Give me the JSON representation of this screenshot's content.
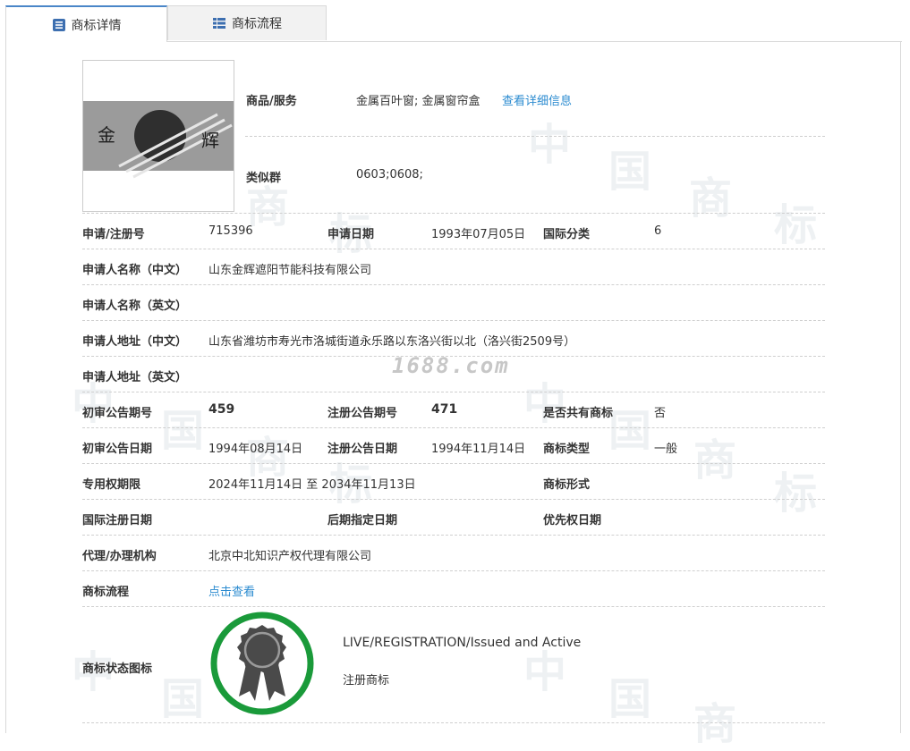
{
  "tabs": [
    {
      "label": "商标详情",
      "icon": "document-list-icon",
      "active": true
    },
    {
      "label": "商标流程",
      "icon": "grid-list-icon",
      "active": false
    }
  ],
  "logo": {
    "text_left": "金",
    "text_right": "辉"
  },
  "goods": {
    "label": "商品/服务",
    "value": "金属百叶窗; 金属窗帘盒",
    "link": "查看详细信息"
  },
  "similar": {
    "label": "类似群",
    "value": "0603;0608;"
  },
  "row1": {
    "reg_no_label": "申请/注册号",
    "reg_no": "715396",
    "app_date_label": "申请日期",
    "app_date": "1993年07月05日",
    "intl_class_label": "国际分类",
    "intl_class": "6"
  },
  "applicant_cn": {
    "label": "申请人名称（中文）",
    "value": "山东金辉遮阳节能科技有限公司"
  },
  "applicant_en": {
    "label": "申请人名称（英文）",
    "value": ""
  },
  "address_cn": {
    "label": "申请人地址（中文）",
    "value": "山东省潍坊市寿光市洛城街道永乐路以东洛兴街以北（洛兴街2509号）"
  },
  "address_en": {
    "label": "申请人地址（英文）",
    "value": ""
  },
  "row_pub": {
    "prelim_no_label": "初审公告期号",
    "prelim_no": "459",
    "reg_pub_no_label": "注册公告期号",
    "reg_pub_no": "471",
    "shared_label": "是否共有商标",
    "shared": "否"
  },
  "row_dates": {
    "prelim_date_label": "初审公告日期",
    "prelim_date": "1994年08月14日",
    "reg_pub_date_label": "注册公告日期",
    "reg_pub_date": "1994年11月14日",
    "type_label": "商标类型",
    "type": "一般"
  },
  "row_term": {
    "term_label": "专用权期限",
    "term": "2024年11月14日 至 2034年11月13日",
    "form_label": "商标形式",
    "form": ""
  },
  "row_intl": {
    "intl_reg_label": "国际注册日期",
    "later_label": "后期指定日期",
    "priority_label": "优先权日期"
  },
  "agent": {
    "label": "代理/办理机构",
    "value": "北京中北知识产权代理有限公司"
  },
  "process": {
    "label": "商标流程",
    "link": "点击查看"
  },
  "status": {
    "label": "商标状态图标",
    "en": "LIVE/REGISTRATION/Issued and Active",
    "cn": "注册商标",
    "ring_color": "#1a9a3a",
    "medal_color": "#4a4a4a"
  },
  "watermark": {
    "site": "1688.com",
    "chars": [
      "中",
      "国",
      "商",
      "标"
    ]
  }
}
